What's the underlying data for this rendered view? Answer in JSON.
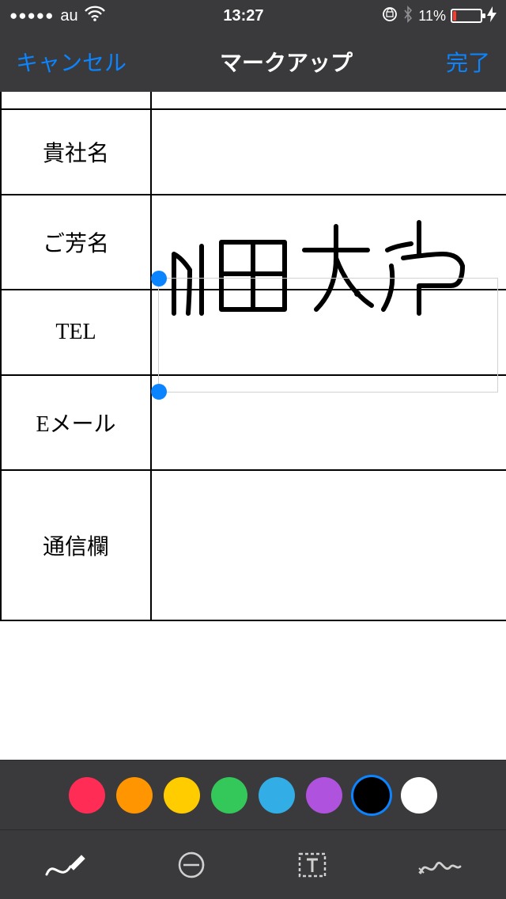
{
  "status": {
    "signal_dots": "●●●●●",
    "carrier": "au",
    "time": "13:27",
    "battery_pct": "11%"
  },
  "nav": {
    "cancel": "キャンセル",
    "title": "マークアップ",
    "done": "完了"
  },
  "form": {
    "rows": [
      {
        "label": "貴社名",
        "value": ""
      },
      {
        "label": "ご芳名",
        "value": "山田太郎"
      },
      {
        "label": "TEL",
        "value": ""
      },
      {
        "label": "Eメール",
        "value": ""
      },
      {
        "label": "通信欄",
        "value": ""
      }
    ]
  },
  "colors": [
    {
      "name": "red",
      "hex": "#ff2d55",
      "selected": false
    },
    {
      "name": "orange",
      "hex": "#ff9500",
      "selected": false
    },
    {
      "name": "yellow",
      "hex": "#ffcc00",
      "selected": false
    },
    {
      "name": "green",
      "hex": "#34c759",
      "selected": false
    },
    {
      "name": "blue",
      "hex": "#32ade6",
      "selected": false
    },
    {
      "name": "purple",
      "hex": "#af52de",
      "selected": false
    },
    {
      "name": "black",
      "hex": "#000000",
      "selected": true
    },
    {
      "name": "white",
      "hex": "#ffffff",
      "selected": false
    }
  ],
  "tools": {
    "pen": {
      "active": true
    },
    "magnifier": {
      "active": false
    },
    "text": {
      "active": false
    },
    "signature": {
      "active": false
    }
  }
}
